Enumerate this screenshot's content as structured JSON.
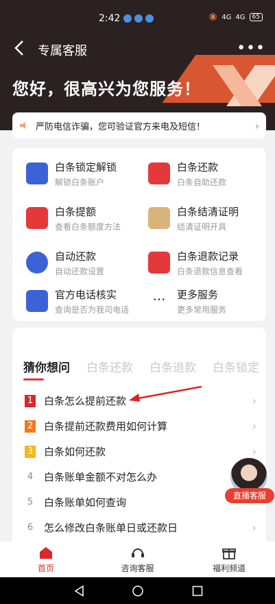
{
  "status": {
    "time": "2:42",
    "battery": "65",
    "net1": "4G",
    "net2": "4G"
  },
  "nav": {
    "title": "专属客服",
    "more": "•••"
  },
  "greeting": "您好，很高兴为您服务！",
  "notice": {
    "text": "严防电信诈骗，您可验证官方来电及短信！"
  },
  "services": [
    {
      "title": "白条锁定解锁",
      "sub": "解锁白条账户",
      "icon": "lock-card-icon",
      "color": "blue"
    },
    {
      "title": "白条还款",
      "sub": "白条自助还款",
      "icon": "repay-card-icon",
      "color": "red"
    },
    {
      "title": "白条提额",
      "sub": "查看白条额度方法",
      "icon": "limit-up-icon",
      "color": "red"
    },
    {
      "title": "白条结清证明",
      "sub": "结清证明开具",
      "icon": "certificate-icon",
      "color": "tan"
    },
    {
      "title": "自动还款",
      "sub": "自动还款设置",
      "icon": "auto-repay-icon",
      "color": "blue"
    },
    {
      "title": "白条退款记录",
      "sub": "白条退款信息查看",
      "icon": "refund-record-icon",
      "color": "red"
    },
    {
      "title": "官方电话核实",
      "sub": "查询是否为我司电话",
      "icon": "phone-verify-icon",
      "color": "blue"
    },
    {
      "title": "更多服务",
      "sub": "更多常用服务",
      "icon": "more-icon",
      "color": "plain"
    }
  ],
  "tabs": [
    "猜你想问",
    "白条还款",
    "白条退款",
    "白条锁定"
  ],
  "questions": [
    {
      "num": "1",
      "text": "白条怎么提前还款"
    },
    {
      "num": "2",
      "text": "白条提前还款费用如何计算"
    },
    {
      "num": "3",
      "text": "白条如何还款"
    },
    {
      "num": "4",
      "text": "白条账单金额不对怎么办"
    },
    {
      "num": "5",
      "text": "白条账单如何查询"
    },
    {
      "num": "6",
      "text": "怎么修改白条账单日或还款日"
    }
  ],
  "live": {
    "label": "直播客服"
  },
  "bottom_nav": [
    {
      "label": "首页",
      "icon": "home-icon"
    },
    {
      "label": "咨询客服",
      "icon": "headset-icon"
    },
    {
      "label": "福利频道",
      "icon": "gift-icon"
    }
  ],
  "colors": {
    "accent": "#d8282c",
    "header": "#2a2120",
    "blue": "#3b63d6"
  }
}
